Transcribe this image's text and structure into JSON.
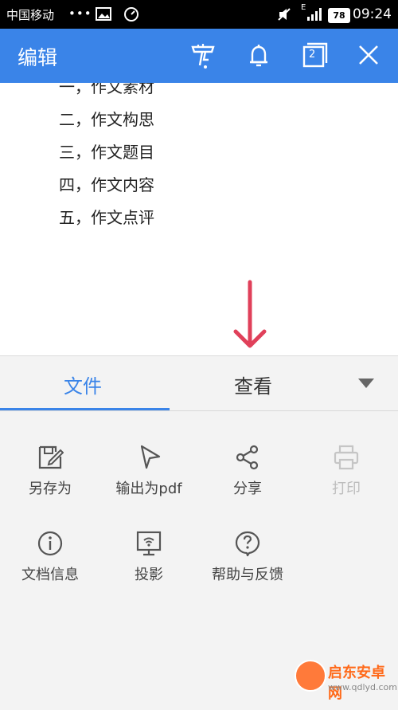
{
  "status_bar": {
    "carrier": "中国移动",
    "dots": "•••",
    "signal_type": "E",
    "battery": "78",
    "time": "09:24"
  },
  "app_bar": {
    "title": "编辑",
    "window_count": "2",
    "accent": "#3a84e8",
    "icons": [
      "format-painter-icon",
      "bell-icon",
      "window-switch-icon",
      "close-icon"
    ]
  },
  "document": {
    "items": [
      "一，作文素材",
      "二，作文构思",
      "三，作文题目",
      "四，作文内容",
      "五，作文点评"
    ]
  },
  "annotation": {
    "arrow_color": "#e0405a"
  },
  "menu": {
    "tabs": [
      {
        "label": "文件",
        "active": true
      },
      {
        "label": "查看",
        "active": false
      }
    ],
    "actions": [
      {
        "label": "另存为",
        "icon": "save-as-icon",
        "enabled": true
      },
      {
        "label": "输出为pdf",
        "icon": "export-pdf-icon",
        "enabled": true
      },
      {
        "label": "分享",
        "icon": "share-icon",
        "enabled": true
      },
      {
        "label": "打印",
        "icon": "print-icon",
        "enabled": false
      },
      {
        "label": "文档信息",
        "icon": "info-icon",
        "enabled": true
      },
      {
        "label": "投影",
        "icon": "projection-icon",
        "enabled": true
      },
      {
        "label": "帮助与反馈",
        "icon": "help-icon",
        "enabled": true
      }
    ]
  },
  "watermark": {
    "text": "启东安卓网",
    "url": "www.qdlyd.com"
  }
}
